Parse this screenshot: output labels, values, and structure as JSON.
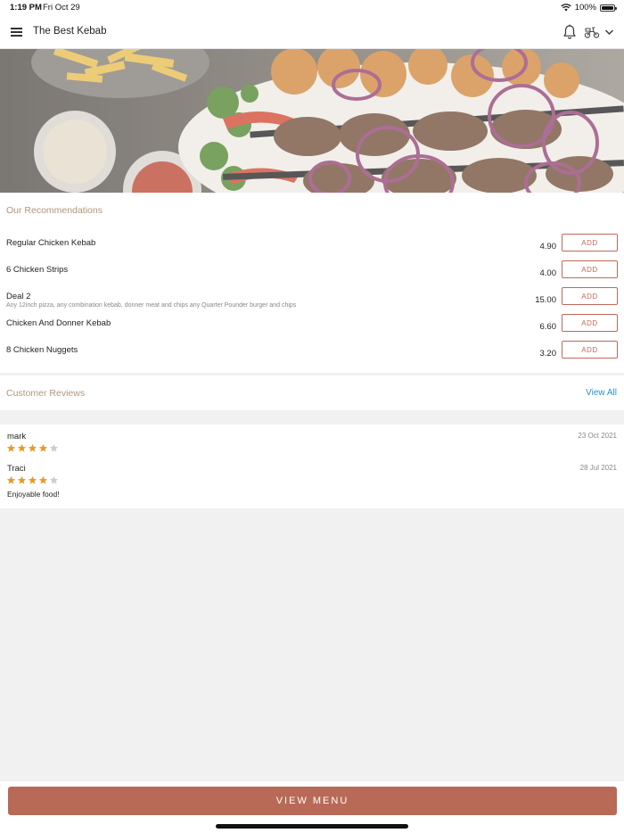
{
  "status_bar": {
    "time": "1:19 PM",
    "date": "Fri Oct 29",
    "battery": "100%",
    "icons": [
      "wifi-icon",
      "battery-icon"
    ]
  },
  "header": {
    "title": "The Best Kebab",
    "icons": [
      "menu-icon",
      "bell-icon",
      "scooter-icon",
      "chevron-down-icon"
    ]
  },
  "recommendations": {
    "title": "Our Recommendations",
    "add_label": "ADD",
    "items": [
      {
        "name": "Regular Chicken Kebab",
        "description": "",
        "price": "4.90"
      },
      {
        "name": "6 Chicken Strips",
        "description": "",
        "price": "4.00"
      },
      {
        "name": "Deal 2",
        "description": "Any 12inch pizza, any combination kebab, donner meat and chips any Quarter Pounder burger and chips",
        "price": "15.00"
      },
      {
        "name": "Chicken And Donner Kebab",
        "description": "",
        "price": "6.60"
      },
      {
        "name": "8 Chicken Nuggets",
        "description": "",
        "price": "3.20"
      }
    ]
  },
  "reviews": {
    "title": "Customer Reviews",
    "view_all_label": "View All",
    "items": [
      {
        "reviewer": "mark",
        "date": "23 Oct 2021",
        "rating": 4,
        "max_rating": 5,
        "comment": ""
      },
      {
        "reviewer": "Traci",
        "date": "28 Jul 2021",
        "rating": 4,
        "max_rating": 5,
        "comment": "Enjoyable food!"
      }
    ]
  },
  "footer": {
    "view_menu_label": "VIEW MENU"
  },
  "colors": {
    "accent": "#b86a57",
    "add_border": "#c0695a",
    "section_title": "#b0957a",
    "link": "#2a8fc6",
    "star_filled": "#e89a2c",
    "star_empty": "#cccccc",
    "background": "#f1f1f1"
  }
}
